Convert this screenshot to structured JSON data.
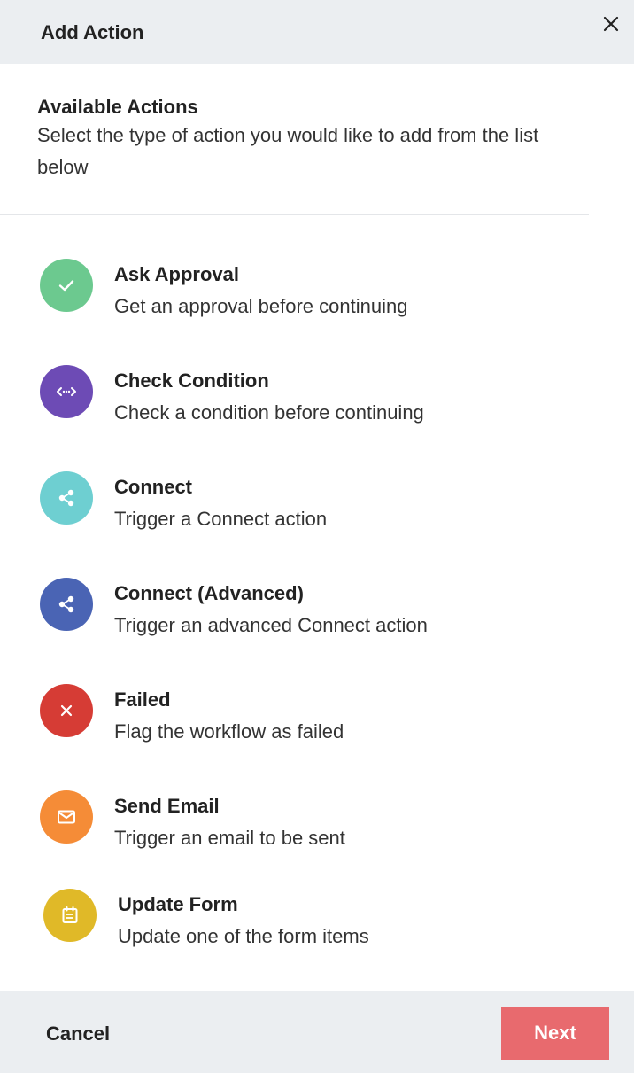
{
  "header": {
    "title": "Add Action",
    "close_icon": "close-icon"
  },
  "intro": {
    "heading": "Available Actions",
    "text": "Select the type of action you would like to add from the list below"
  },
  "actions": [
    {
      "title": "Ask Approval",
      "description": "Get an approval before continuing",
      "icon": "check-icon",
      "color": "#6cc98f"
    },
    {
      "title": "Check Condition",
      "description": "Check a condition before continuing",
      "icon": "code-condition-icon",
      "color": "#6d4bb5"
    },
    {
      "title": "Connect",
      "description": "Trigger a Connect action",
      "icon": "share-icon",
      "color": "#6ecfd1"
    },
    {
      "title": "Connect (Advanced)",
      "description": "Trigger an advanced Connect action",
      "icon": "share-icon",
      "color": "#4a64b4"
    },
    {
      "title": "Failed",
      "description": "Flag the workflow as failed",
      "icon": "close-icon",
      "color": "#d63c35"
    },
    {
      "title": "Send Email",
      "description": "Trigger an email to be sent",
      "icon": "mail-icon",
      "color": "#f58c37"
    },
    {
      "title": "Update Form",
      "description": "Update one of the form items",
      "icon": "form-icon",
      "color": "#e0b928"
    }
  ],
  "footer": {
    "cancel_label": "Cancel",
    "next_label": "Next",
    "next_color": "#e86a6e"
  }
}
